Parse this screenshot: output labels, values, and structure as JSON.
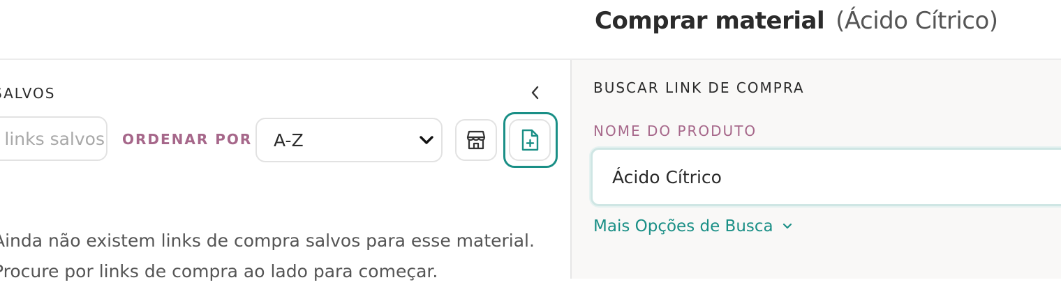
{
  "header": {
    "title": "Comprar material",
    "subtitle": "(Ácido Cítrico)"
  },
  "left_panel": {
    "section_title": "SALVOS",
    "search": {
      "placeholder": "Buscar links salvos",
      "value": ""
    },
    "sort": {
      "label": "ORDENAR POR",
      "selected": "A-Z"
    },
    "icons": {
      "collapse": "chevron-left-icon",
      "store": "store-icon",
      "new_file": "file-plus-icon"
    },
    "empty_message": "Ainda não existem links de compra salvos para esse material. Procure por links de compra ao lado para começar."
  },
  "right_panel": {
    "section_title": "BUSCAR LINK DE COMPRA",
    "product_field": {
      "label": "NOME DO PRODUTO",
      "value": "Ácido Cítrico"
    },
    "more_options": "Mais Opções de Busca"
  },
  "colors": {
    "accent_teal": "#1a8f86",
    "label_pink": "#a6678a",
    "panel_bg": "#f9f8f7"
  }
}
